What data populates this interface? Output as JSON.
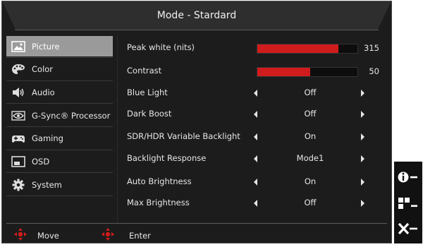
{
  "title": "Mode - Stardard",
  "sidebar": {
    "items": [
      {
        "label": "Picture",
        "icon": "picture-icon",
        "active": true
      },
      {
        "label": "Color",
        "icon": "palette-icon",
        "active": false
      },
      {
        "label": "Audio",
        "icon": "speaker-icon",
        "active": false
      },
      {
        "label": "G-Sync® Processor",
        "icon": "nvidia-eye-icon",
        "active": false
      },
      {
        "label": "Gaming",
        "icon": "gamepad-icon",
        "active": false
      },
      {
        "label": "OSD",
        "icon": "osd-icon",
        "active": false
      },
      {
        "label": "System",
        "icon": "gear-icon",
        "active": false
      }
    ]
  },
  "settings": {
    "peak_white": {
      "label": "Peak white (nits)",
      "value": "315",
      "fill_fraction": 0.81
    },
    "contrast": {
      "label": "Contrast",
      "value": "50",
      "fill_fraction": 0.53
    },
    "options": [
      {
        "label": "Blue Light",
        "value": "Off"
      },
      {
        "label": "Dark Boost",
        "value": "Off"
      },
      {
        "label": "SDR/HDR Variable Backlight",
        "value": "On"
      },
      {
        "label": "Backlight Response",
        "value": "Mode1"
      },
      {
        "label": "Auto Brightness",
        "value": "On"
      },
      {
        "label": "Max Brightness",
        "value": "Off"
      }
    ]
  },
  "footer": {
    "move_label": "Move",
    "enter_label": "Enter"
  },
  "colors": {
    "accent": "#d01c1c",
    "active_bg": "#9a9a9a",
    "panel_bg": "#1c1c1c"
  },
  "right_panel": {
    "buttons": [
      "info-icon",
      "input-icon",
      "exit-icon"
    ]
  }
}
